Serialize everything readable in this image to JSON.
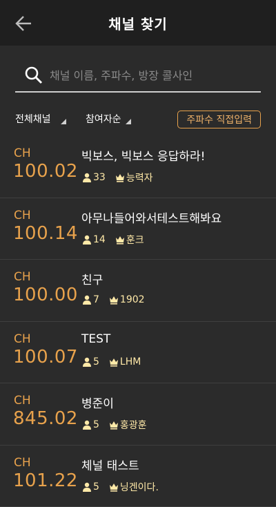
{
  "header": {
    "title": "채널 찾기"
  },
  "search": {
    "placeholder": "채널 이름, 주파수, 방장 콜사인"
  },
  "filters": {
    "all_channels": "전체채널",
    "participants": "참여자순",
    "direct_input": "주파수 직접입력"
  },
  "colors": {
    "accent": "#e8a24c",
    "meta": "#ffe9a8",
    "background": "#2b2b2b",
    "header": "#1f1f1f"
  },
  "channels": [
    {
      "ch": "CH",
      "freq": "100.02",
      "name": "빅보스, 빅보스 응답하라!",
      "users": "33",
      "host": "능력자"
    },
    {
      "ch": "CH",
      "freq": "100.14",
      "name": "아무나들어와서테스트해봐요",
      "users": "14",
      "host": "훈크"
    },
    {
      "ch": "CH",
      "freq": "100.00",
      "name": "친구",
      "users": "7",
      "host": "1902"
    },
    {
      "ch": "CH",
      "freq": "100.07",
      "name": "TEST",
      "users": "5",
      "host": "LHM"
    },
    {
      "ch": "CH",
      "freq": "845.02",
      "name": "병준이",
      "users": "5",
      "host": "홍광훈"
    },
    {
      "ch": "CH",
      "freq": "101.22",
      "name": "체널  태스트",
      "users": "5",
      "host": "닝겐이다."
    }
  ]
}
